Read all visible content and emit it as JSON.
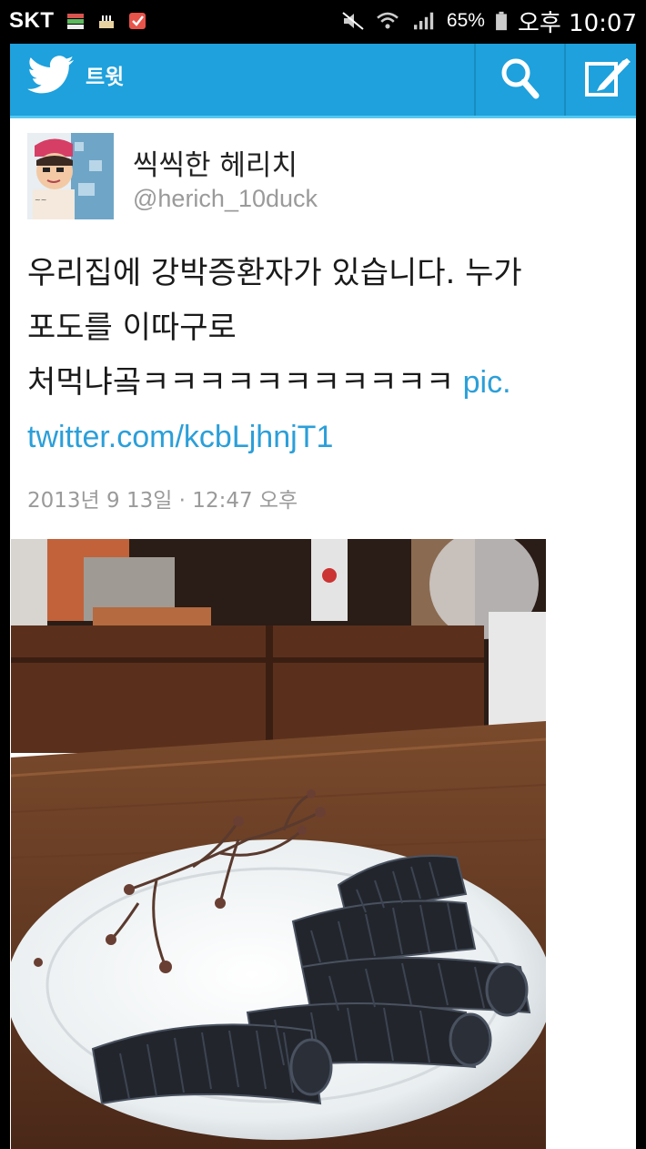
{
  "status_bar": {
    "carrier": "SKT",
    "battery": "65%",
    "time": "오후 10:07"
  },
  "header": {
    "title": "트윗",
    "brand_color": "#1ea1dc"
  },
  "tweet": {
    "display_name": "씩씩한 헤리치",
    "handle": "@herich_10duck",
    "text_line1": "우리집에 강박증환자가 있습니다. 누가",
    "text_line2": "포도를 이따구로",
    "text_line3": "처먹냐곸ㅋㅋㅋㅋㅋㅋㅋㅋㅋㅋㅋ",
    "link_part1": " pic.",
    "link_part2": "twitter.com/kcbLjhnjT1",
    "link_color": "#2b9fd9",
    "timestamp": "2013년 9 13일 · 12:47 오후"
  },
  "icons": [
    "twitter-bird-icon",
    "search-icon",
    "compose-icon",
    "wifi-icon",
    "signal-icon",
    "battery-icon",
    "mute-icon"
  ]
}
